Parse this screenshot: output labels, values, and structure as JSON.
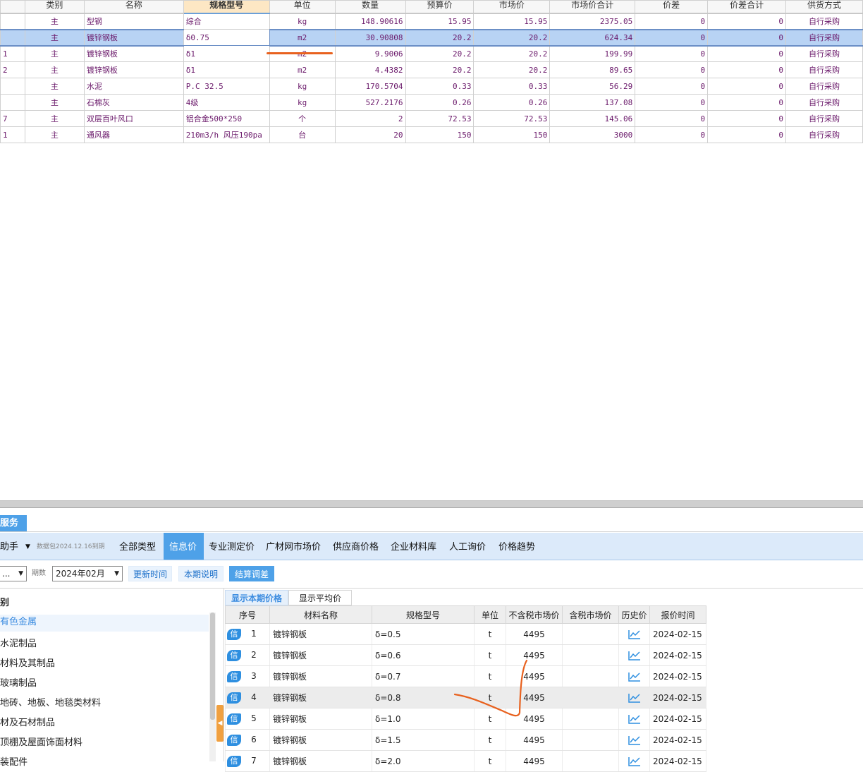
{
  "upper_table": {
    "columns": [
      "类别",
      "名称",
      "规格型号",
      "单位",
      "数量",
      "预算价",
      "市场价",
      "市场价合计",
      "价差",
      "价差合计",
      "供货方式"
    ],
    "rows": [
      {
        "code": "",
        "type": "主",
        "name": "型钢",
        "spec": "综合",
        "unit": "kg",
        "qty": "148.90616",
        "budget": "15.95",
        "market": "15.95",
        "total": "2375.05",
        "diff": "0",
        "diff_total": "0",
        "supply": "自行采购"
      },
      {
        "code": "",
        "type": "主",
        "name": "镀锌钢板",
        "spec": "δ0.75",
        "unit": "m2",
        "qty": "30.90808",
        "budget": "20.2",
        "market": "20.2",
        "total": "624.34",
        "diff": "0",
        "diff_total": "0",
        "supply": "自行采购"
      },
      {
        "code": "1",
        "type": "主",
        "name": "镀锌钢板",
        "spec": "δ1",
        "unit": "m2",
        "qty": "9.9006",
        "budget": "20.2",
        "market": "20.2",
        "total": "199.99",
        "diff": "0",
        "diff_total": "0",
        "supply": "自行采购"
      },
      {
        "code": "2",
        "type": "主",
        "name": "镀锌钢板",
        "spec": "δ1",
        "unit": "m2",
        "qty": "4.4382",
        "budget": "20.2",
        "market": "20.2",
        "total": "89.65",
        "diff": "0",
        "diff_total": "0",
        "supply": "自行采购"
      },
      {
        "code": "",
        "type": "主",
        "name": "水泥",
        "spec": "P.C 32.5",
        "unit": "kg",
        "qty": "170.5704",
        "budget": "0.33",
        "market": "0.33",
        "total": "56.29",
        "diff": "0",
        "diff_total": "0",
        "supply": "自行采购"
      },
      {
        "code": "",
        "type": "主",
        "name": "石棉灰",
        "spec": "4级",
        "unit": "kg",
        "qty": "527.2176",
        "budget": "0.26",
        "market": "0.26",
        "total": "137.08",
        "diff": "0",
        "diff_total": "0",
        "supply": "自行采购"
      },
      {
        "code": "7",
        "type": "主",
        "name": "双层百叶风口",
        "spec": "铝合金500*250",
        "unit": "个",
        "qty": "2",
        "budget": "72.53",
        "market": "72.53",
        "total": "145.06",
        "diff": "0",
        "diff_total": "0",
        "supply": "自行采购"
      },
      {
        "code": "1",
        "type": "主",
        "name": "通风器",
        "spec": "210m3/h 风压190pa",
        "unit": "台",
        "qty": "20",
        "budget": "150",
        "market": "150",
        "total": "3000",
        "diff": "0",
        "diff_total": "0",
        "supply": "自行采购"
      }
    ]
  },
  "service_tab": "服务",
  "assistant": {
    "label": "助手",
    "package": "数据包2024.12.16到期"
  },
  "nav_tabs": [
    "全部类型",
    "信息价",
    "专业测定价",
    "广材网市场价",
    "供应商价格",
    "企业材料库",
    "人工询价",
    "价格趋势"
  ],
  "toolbar": {
    "region_value": "...",
    "period_label": "期数",
    "period_value": "2024年02月",
    "update_time": "更新时间",
    "period_note": "本期说明",
    "settle_adjust": "结算调差"
  },
  "tree": {
    "header": "别",
    "items": [
      "有色金属",
      "水泥制品",
      "材料及其制品",
      "玻璃制品",
      "地砖、地板、地毯类材料",
      "材及石材制品",
      "顶棚及屋面饰面材料",
      "装配件"
    ]
  },
  "sub_tabs": [
    "显示本期价格",
    "显示平均价"
  ],
  "price_table": {
    "columns": [
      "序号",
      "材料名称",
      "规格型号",
      "单位",
      "不含税市场价",
      "含税市场价",
      "历史价",
      "报价时间"
    ],
    "badge": "信",
    "rows": [
      {
        "no": "1",
        "name": "镀锌钢板",
        "spec": "δ=0.5",
        "unit": "t",
        "price": "4495",
        "tax_price": "",
        "date": "2024-02-15"
      },
      {
        "no": "2",
        "name": "镀锌钢板",
        "spec": "δ=0.6",
        "unit": "t",
        "price": "4495",
        "tax_price": "",
        "date": "2024-02-15"
      },
      {
        "no": "3",
        "name": "镀锌钢板",
        "spec": "δ=0.7",
        "unit": "t",
        "price": "4495",
        "tax_price": "",
        "date": "2024-02-15"
      },
      {
        "no": "4",
        "name": "镀锌钢板",
        "spec": "δ=0.8",
        "unit": "t",
        "price": "4495",
        "tax_price": "",
        "date": "2024-02-15"
      },
      {
        "no": "5",
        "name": "镀锌钢板",
        "spec": "δ=1.0",
        "unit": "t",
        "price": "4495",
        "tax_price": "",
        "date": "2024-02-15"
      },
      {
        "no": "6",
        "name": "镀锌钢板",
        "spec": "δ=1.5",
        "unit": "t",
        "price": "4495",
        "tax_price": "",
        "date": "2024-02-15"
      },
      {
        "no": "7",
        "name": "镀锌钢板",
        "spec": "δ=2.0",
        "unit": "t",
        "price": "4495",
        "tax_price": "",
        "date": "2024-02-15"
      }
    ]
  },
  "colors": {
    "accent": "#4ea1e8",
    "annotation": "#e8611e",
    "text_purple": "#6b1a6b"
  }
}
